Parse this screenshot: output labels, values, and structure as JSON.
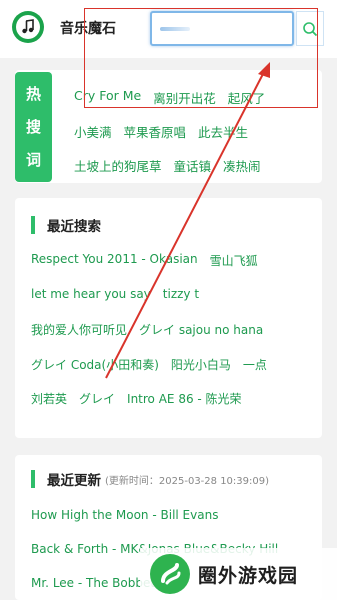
{
  "header": {
    "app_title": "音乐魔石",
    "search_value": ""
  },
  "hot": {
    "tag_chars": [
      "热",
      "搜",
      "词"
    ],
    "rows": [
      [
        "Cry For Me",
        "离别开出花",
        "起风了"
      ],
      [
        "小美满",
        "苹果香原唱",
        "此去半生"
      ],
      [
        "土坡上的狗尾草",
        "童话镇",
        "凑热闹"
      ]
    ]
  },
  "recent_search": {
    "title": "最近搜索",
    "rows": [
      [
        "Respect You 2011 - Okasian",
        "雪山飞狐"
      ],
      [
        "let me hear you say",
        "tizzy t"
      ],
      [
        "我的爱人你可听见",
        "グレイ sajou no hana"
      ],
      [
        "グレイ Coda(小田和奏)",
        "阳光小白马",
        "一点"
      ],
      [
        "刘若英",
        "グレイ",
        "Intro AE 86 - 陈光荣"
      ]
    ]
  },
  "latest_update": {
    "title": "最近更新",
    "subtitle": "(更新时间：2025-03-28 10:39:09)",
    "items": [
      "How High the Moon - Bill Evans",
      "Back & Forth - MK&Jonas Blue&Becky Hill",
      "Mr. Lee - The Bobbettes"
    ]
  },
  "watermark": {
    "text": "圈外游戏园"
  },
  "colors": {
    "accent_green": "#2ebd6a",
    "link_green": "#1e9a4f",
    "annotation_red": "#d9342b",
    "search_border": "#7fb7e8"
  },
  "icons": [
    "music-note-icon",
    "search-icon",
    "watermark-logo-icon"
  ]
}
